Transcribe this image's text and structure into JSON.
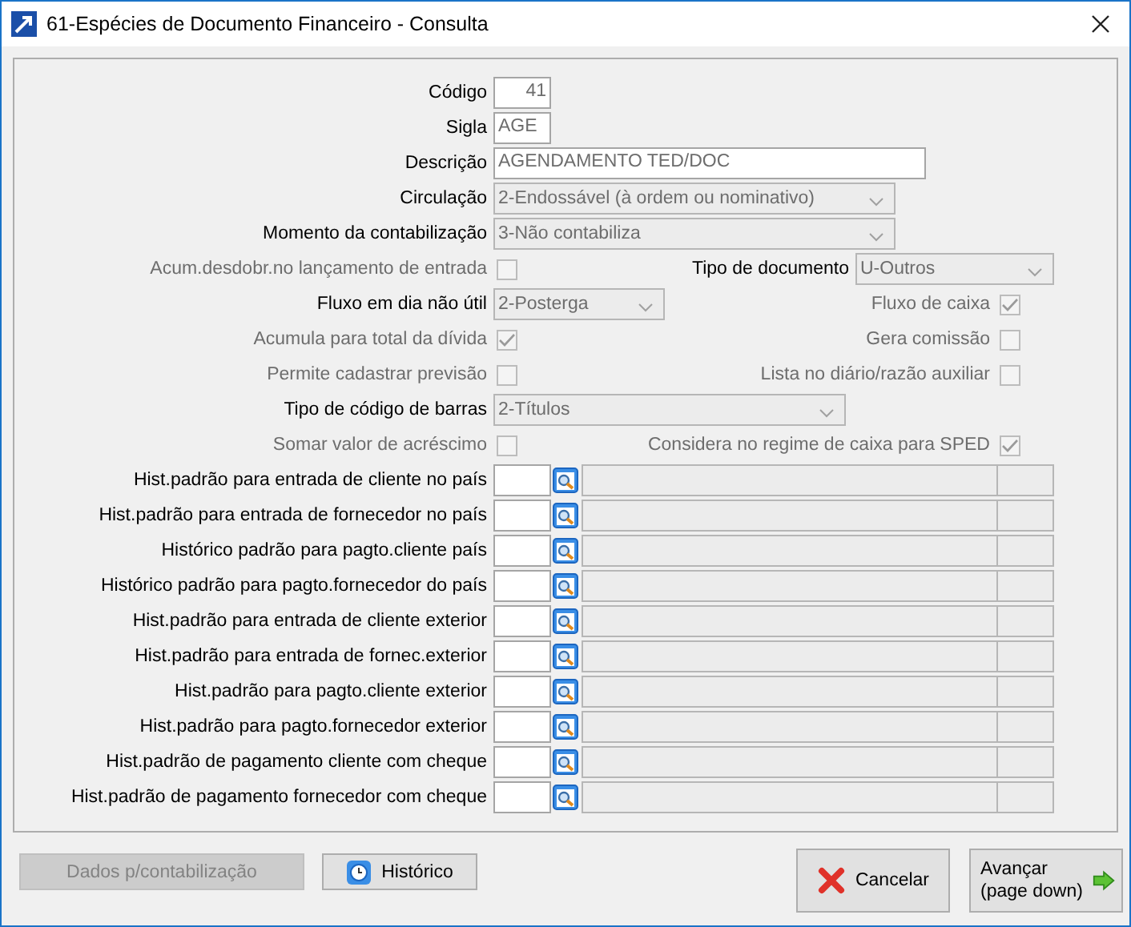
{
  "window": {
    "title": "61-Espécies de Documento Financeiro - Consulta"
  },
  "rows": [
    {
      "left": {
        "kind": "number",
        "label": "Código",
        "value": "41"
      }
    },
    {
      "left": {
        "kind": "text",
        "label": "Sigla",
        "value": "AGE"
      }
    },
    {
      "left": {
        "kind": "text",
        "label": "Descrição",
        "value": "AGENDAMENTO TED/DOC"
      }
    },
    {
      "left": {
        "kind": "combo",
        "label": "Circulação",
        "value": "2-Endossável (à ordem ou nominativo)"
      }
    },
    {
      "left": {
        "kind": "combo",
        "label": "Momento da contabilização",
        "value": "3-Não contabiliza"
      }
    },
    {
      "left": {
        "kind": "checkbox",
        "label": "Acum.desdobr.no lançamento de entrada",
        "checked": false,
        "disabled": true
      },
      "right": {
        "kind": "combo",
        "label": "Tipo de documento",
        "value": "U-Outros"
      }
    },
    {
      "left": {
        "kind": "combo",
        "label": "Fluxo em dia não útil",
        "value": "2-Posterga"
      },
      "right": {
        "kind": "checkbox",
        "label": "Fluxo de caixa",
        "checked": true,
        "disabled": true
      }
    },
    {
      "left": {
        "kind": "checkbox",
        "label": "Acumula para total da dívida",
        "checked": true,
        "disabled": true
      },
      "right": {
        "kind": "checkbox",
        "label": "Gera comissão",
        "checked": false,
        "disabled": true
      }
    },
    {
      "left": {
        "kind": "checkbox",
        "label": "Permite cadastrar previsão",
        "checked": false,
        "disabled": true
      },
      "right": {
        "kind": "checkbox",
        "label": "Lista no diário/razão auxiliar",
        "checked": false,
        "disabled": true
      }
    },
    {
      "left": {
        "kind": "combo",
        "label": "Tipo de código de barras",
        "value": "2-Títulos"
      }
    },
    {
      "left": {
        "kind": "checkbox",
        "label": "Somar valor de acréscimo",
        "checked": false,
        "disabled": true
      },
      "right": {
        "kind": "checkbox",
        "label": "Considera no regime de caixa para SPED",
        "checked": true,
        "disabled": true
      }
    }
  ],
  "history_fields": [
    "Hist.padrão para entrada de cliente no país",
    "Hist.padrão para entrada de fornecedor no país",
    "Histórico padrão para pagto.cliente país",
    "Histórico padrão para pagto.fornecedor do país",
    "Hist.padrão para entrada de cliente exterior",
    "Hist.padrão para entrada de fornec.exterior",
    "Hist.padrão para pagto.cliente exterior",
    "Hist.padrão para pagto.fornecedor exterior",
    "Hist.padrão de pagamento cliente com cheque",
    "Hist.padrão de pagamento fornecedor com cheque"
  ],
  "buttons": [
    {
      "kind": "plain",
      "label": "Dados p/contabilização",
      "disabled": true
    },
    {
      "kind": "history",
      "label": "Histórico",
      "disabled": false
    },
    {
      "kind": "cancel",
      "label": "Cancelar",
      "disabled": false
    },
    {
      "kind": "next",
      "label": "Avançar\n(page down)",
      "disabled": false
    }
  ]
}
